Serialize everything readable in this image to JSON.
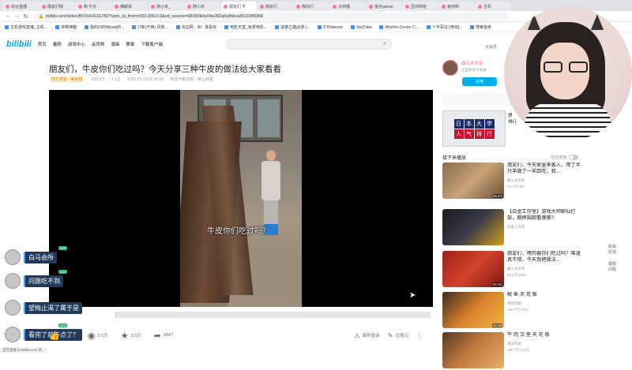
{
  "browser": {
    "tabs": [
      {
        "label": "综合直播",
        "active": false
      },
      {
        "label": "朋友们嗯",
        "active": false
      },
      {
        "label": "和 牛天",
        "active": false
      },
      {
        "label": "佛朗哥",
        "active": false
      },
      {
        "label": "骑小米_",
        "active": false
      },
      {
        "label": "骑小米",
        "active": false
      },
      {
        "label": "朋友们 牛",
        "active": true
      },
      {
        "label": "朋友们",
        "active": false
      },
      {
        "label": "我的们",
        "active": false
      },
      {
        "label": "大肉哩",
        "active": false
      },
      {
        "label": "猎手gamer",
        "active": false
      },
      {
        "label": "豆肉熟哈",
        "active": false
      },
      {
        "label": "食肉熟",
        "active": false
      },
      {
        "label": "主机",
        "active": false
      }
    ],
    "url": "bilibili.com/video/BV1kF411E782?spm_id_from=333.999.0.0&vd_source=98260b0e04e282a6af8dca3011998368",
    "bookmarks": [
      "主机游戏直播_主机...",
      "单嘤神器",
      "我的ID的Miyuki的...",
      "(7新)不换) 风景...",
      "淘宝网 - 淘！我喜欢",
      "电影天堂_免费电影...",
      "逆袭之路@通 (...",
      "P Pinterest",
      "YouTube",
      "Rhythm Doctor C...",
      "十字军征 [电线]...",
      "搜索首条"
    ]
  },
  "site_header": {
    "logo": "bilibili",
    "nav": [
      "首页",
      "番剧",
      "游戏中心",
      "会员购",
      "漫画",
      "赛事",
      "下载客户端"
    ],
    "right_label": "大会员"
  },
  "video": {
    "title": "朋友们，牛皮你们吃过吗？今天分享三种牛皮的做法给大家看看",
    "badge": "前方高能 · 美食榜",
    "views": "330.5万",
    "danmaku_count": "1.1万",
    "date": "2022-02-19 11:05:00",
    "copyright": "未经作者授权，禁止转载",
    "subtitle": "牛皮你们吃过吗？"
  },
  "danmaku": [
    {
      "text": "白马会所",
      "tag": "LV3"
    },
    {
      "text": "问题吃不到",
      "tag": "LV4"
    },
    {
      "text": "望梅止渴了属于是",
      "tag": ""
    },
    {
      "text": "看完了就不点了？",
      "tag": "LV4"
    }
  ],
  "toolbar": {
    "like": "18.9万",
    "coin": "3.5万",
    "favorite": "3.0万",
    "share": "9347",
    "report": "稿件投诉",
    "note": "记笔记"
  },
  "uploader": {
    "name": "曲小米梁梁",
    "desc": "这里有关于美食...",
    "follow": "充电"
  },
  "ad": {
    "chars": [
      "日",
      "本",
      "大",
      "学",
      "人",
      "气",
      "排",
      "行"
    ],
    "text_line1": "想",
    "text_line2": "排行"
  },
  "next_up": {
    "label": "接下来播放",
    "autoplay": "自动连播"
  },
  "recommendations": [
    {
      "title": "朋友们，今天家里来客人，用了半只羊做了一羊四吃，我...",
      "up": "曲小米梁梁",
      "views": "70.7万",
      "comments": "947",
      "duration": "04:14"
    },
    {
      "title": "【白金工作室】游戏大师聊仙打架，都摔围观看傻搬？",
      "up": "白金工作室",
      "views": "",
      "comments": "",
      "duration": ""
    },
    {
      "title": "朋友们，嘿肉酱你们吃过吗？味道真不错，今天我把做法...",
      "up": "曲小米梁梁",
      "views": "58.2万",
      "comments": "5407",
      "duration": "04:15"
    },
    {
      "title": "鱿 鱼 天 花 板",
      "up": "黄焖鸡剧",
      "views": "180.7万",
      "comments": "8761",
      "duration": "06:58"
    },
    {
      "title": "牛 肉 汉 堡 天 花 板",
      "up": "黄焖鸡剧",
      "views": "180.7万",
      "comments": "1.4万",
      "duration": ""
    }
  ],
  "side_tools": [
    "新版",
    "反馈",
    "客服",
    "问题"
  ],
  "status": "正在连接 i0.hdslb.com 的..."
}
